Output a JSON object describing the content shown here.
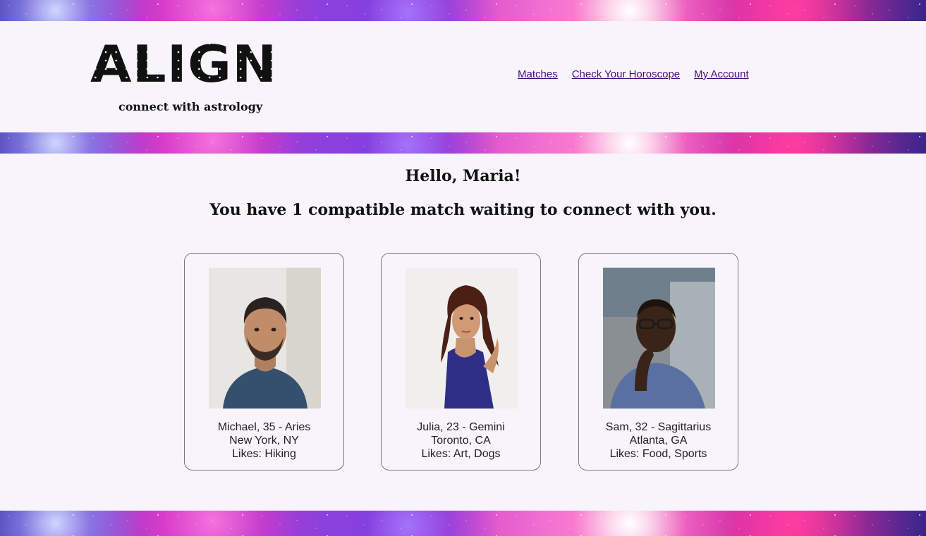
{
  "app": {
    "logo": "ALIGN",
    "tagline": "connect with astrology"
  },
  "nav": {
    "items": [
      {
        "label": "Matches"
      },
      {
        "label": "Check Your Horoscope"
      },
      {
        "label": "My Account"
      }
    ],
    "link_color": "#4b0a7a"
  },
  "main": {
    "greeting": "Hello, Maria!",
    "message": "You have 1 compatible match waiting to connect with you."
  },
  "matches": [
    {
      "name_line": "Michael, 35 - Aries",
      "location": "New York, NY",
      "likes": "Likes: Hiking"
    },
    {
      "name_line": "Julia, 23 - Gemini",
      "location": "Toronto, CA",
      "likes": "Likes: Art, Dogs"
    },
    {
      "name_line": "Sam, 32 - Sagittarius",
      "location": "Atlanta, GA",
      "likes": "Likes: Food, Sports"
    }
  ]
}
